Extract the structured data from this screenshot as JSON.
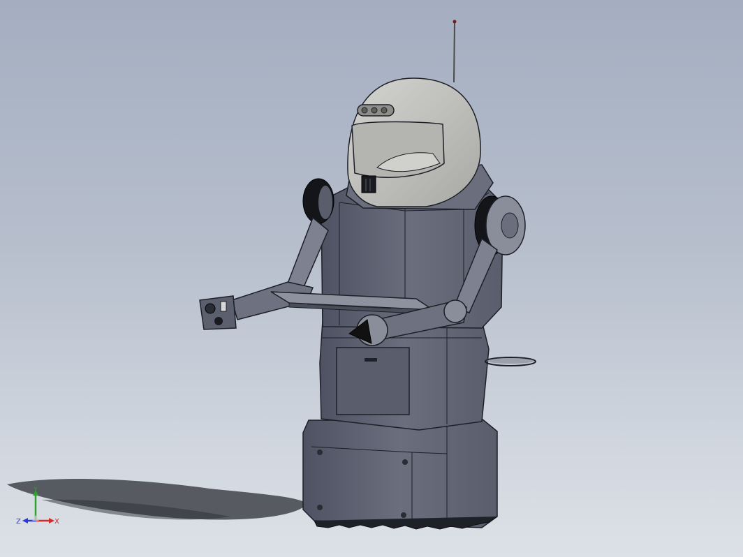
{
  "viewport": {
    "model": "robot-assembly",
    "background_top": "#a4aec0",
    "background_bottom": "#dde1e7",
    "body_color": "#5e6270",
    "helmet_color": "#bcbcb8",
    "shadow_color": "#2c2f36"
  },
  "triad": {
    "x_label": "X",
    "y_label": "Y",
    "z_label": "Z",
    "x_color": "#d42a2a",
    "y_color": "#2aa52a",
    "z_color": "#2a3ad4"
  }
}
